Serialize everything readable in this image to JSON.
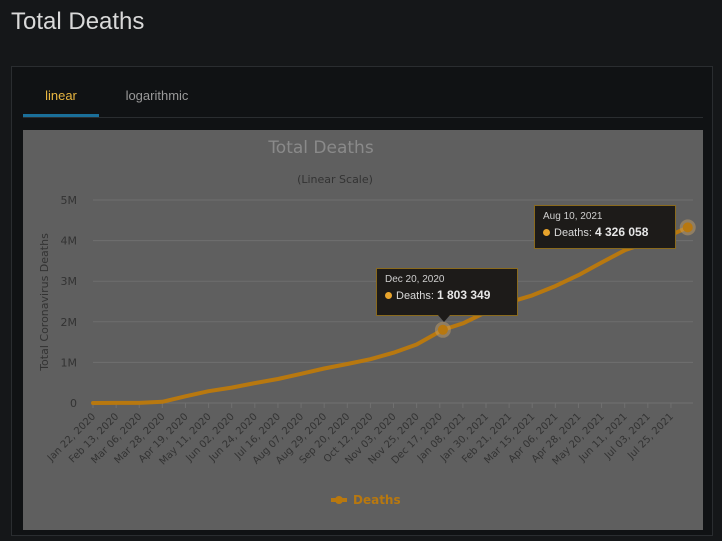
{
  "page": {
    "title": "Total Deaths"
  },
  "tabs": [
    {
      "label": "linear",
      "active": true
    },
    {
      "label": "logarithmic",
      "active": false
    }
  ],
  "colors": {
    "series": "#b8780f",
    "background": "#5f5f5f",
    "tab_active": "#e8b640",
    "tab_underline": "#1a6f9a"
  },
  "tooltips": [
    {
      "date": "Dec 20, 2020",
      "label": "Deaths:",
      "value": "1 803 349"
    },
    {
      "date": "Aug 10, 2021",
      "label": "Deaths:",
      "value": "4 326 058"
    }
  ],
  "chart_data": {
    "type": "line",
    "title": "Total Deaths",
    "subtitle": "(Linear Scale)",
    "xlabel": "",
    "ylabel": "Total Coronavirus Deaths",
    "ylim": [
      0,
      5000000
    ],
    "yticks": [
      0,
      1000000,
      2000000,
      3000000,
      4000000,
      5000000
    ],
    "ytick_labels": [
      "0",
      "1M",
      "2M",
      "3M",
      "4M",
      "5M"
    ],
    "xtick_labels": [
      "Jan 22, 2020",
      "Feb 13, 2020",
      "Mar 06, 2020",
      "Mar 28, 2020",
      "Apr 19, 2020",
      "May 11, 2020",
      "Jun 02, 2020",
      "Jun 24, 2020",
      "Jul 16, 2020",
      "Aug 07, 2020",
      "Aug 29, 2020",
      "Sep 20, 2020",
      "Oct 12, 2020",
      "Nov 03, 2020",
      "Nov 25, 2020",
      "Dec 17, 2020",
      "Jan 08, 2021",
      "Jan 30, 2021",
      "Feb 21, 2021",
      "Mar 15, 2021",
      "Apr 06, 2021",
      "Apr 28, 2021",
      "May 20, 2021",
      "Jun 11, 2021",
      "Jul 03, 2021",
      "Jul 25, 2021"
    ],
    "grid": true,
    "legend": "bottom-center",
    "series": [
      {
        "name": "Deaths",
        "x": [
          "2020-01-22",
          "2020-02-13",
          "2020-03-06",
          "2020-03-28",
          "2020-04-19",
          "2020-05-11",
          "2020-06-02",
          "2020-06-24",
          "2020-07-16",
          "2020-08-07",
          "2020-08-29",
          "2020-09-20",
          "2020-10-12",
          "2020-11-03",
          "2020-11-25",
          "2020-12-17",
          "2020-12-20",
          "2021-01-08",
          "2021-01-30",
          "2021-02-21",
          "2021-03-15",
          "2021-04-06",
          "2021-04-28",
          "2021-05-20",
          "2021-06-11",
          "2021-07-03",
          "2021-07-25",
          "2021-08-10"
        ],
        "y": [
          17,
          1400,
          3400,
          30000,
          165000,
          290000,
          380000,
          490000,
          590000,
          720000,
          850000,
          960000,
          1080000,
          1240000,
          1440000,
          1760000,
          1803349,
          1960000,
          2240000,
          2480000,
          2650000,
          2880000,
          3150000,
          3460000,
          3760000,
          3960000,
          4140000,
          4326058
        ]
      }
    ],
    "highlighted": [
      {
        "x": "2020-12-20",
        "y": 1803349
      },
      {
        "x": "2021-08-10",
        "y": 4326058
      }
    ]
  }
}
